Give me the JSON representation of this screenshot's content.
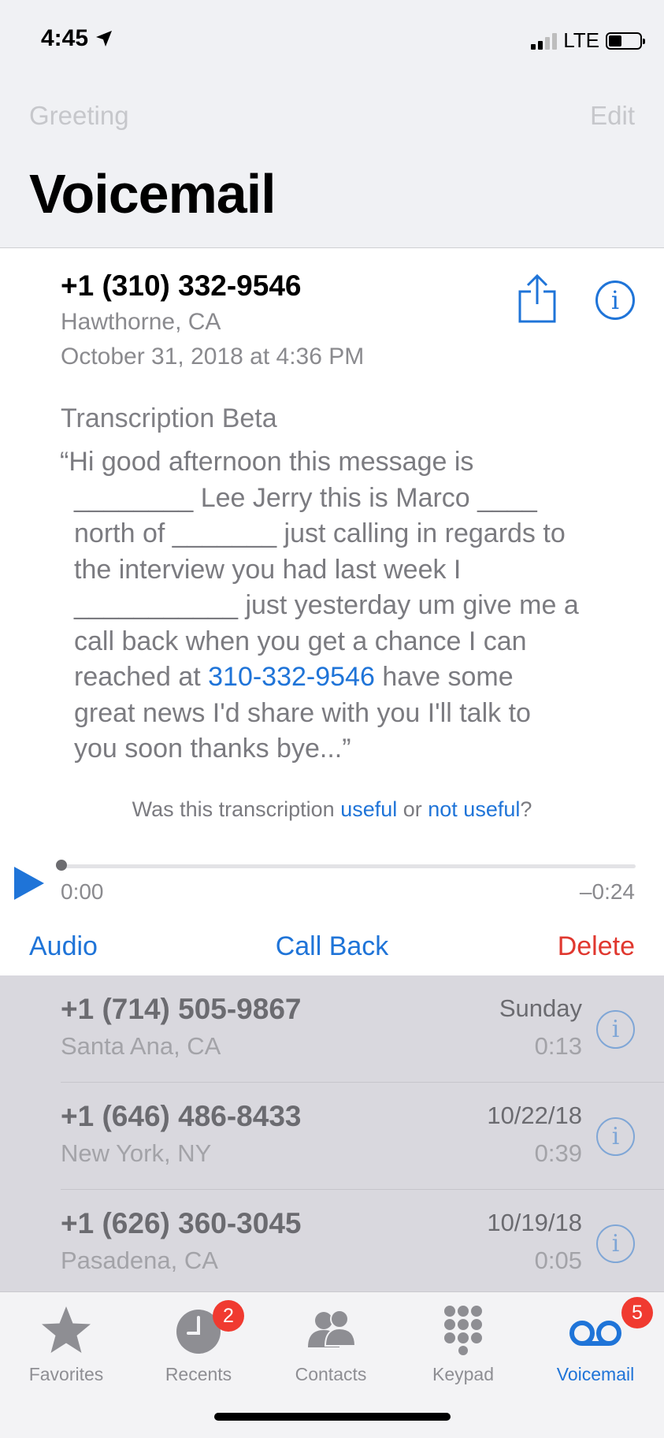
{
  "status_bar": {
    "time": "4:45",
    "network": "LTE"
  },
  "nav": {
    "greeting": "Greeting",
    "edit": "Edit",
    "title": "Voicemail"
  },
  "selected_voicemail": {
    "number": "+1 (310) 332-9546",
    "location": "Hawthorne, CA",
    "date": "October 31, 2018 at 4:36 PM",
    "transcription_label": "Transcription Beta",
    "transcript_lines": [
      "“Hi good afternoon this message is",
      "________ Lee Jerry this is Marco ____",
      "north of _______ just calling in regards to",
      "the interview you had last week I",
      "___________ just yesterday um give me a",
      "call back when you get a chance I can"
    ],
    "transcript_line7_before": "reached at ",
    "transcript_phone_link": "310-332-9546",
    "transcript_line7_after": " have some",
    "transcript_lines_end": [
      "great news I'd share with you I'll talk to",
      "you soon thanks bye...”"
    ],
    "feedback": {
      "prefix": "Was this transcription ",
      "useful": "useful",
      "or": " or ",
      "not_useful": "not useful",
      "suffix": "?"
    },
    "playback": {
      "elapsed": "0:00",
      "remaining": "–0:24",
      "progress": 0.0
    },
    "actions": {
      "audio": "Audio",
      "call_back": "Call Back",
      "delete": "Delete"
    }
  },
  "voicemails": [
    {
      "number": "+1 (714) 505-9867",
      "location": "Santa Ana, CA",
      "date": "Sunday",
      "duration": "0:13"
    },
    {
      "number": "+1 (646) 486-8433",
      "location": "New York, NY",
      "date": "10/22/18",
      "duration": "0:39"
    },
    {
      "number": "+1 (626) 360-3045",
      "location": "Pasadena, CA",
      "date": "10/19/18",
      "duration": "0:05"
    }
  ],
  "tabs": [
    {
      "label": "Favorites",
      "icon": "star-icon"
    },
    {
      "label": "Recents",
      "icon": "clock-icon",
      "badge": "2"
    },
    {
      "label": "Contacts",
      "icon": "contacts-icon"
    },
    {
      "label": "Keypad",
      "icon": "keypad-icon"
    },
    {
      "label": "Voicemail",
      "icon": "voicemail-icon",
      "badge": "5",
      "active": true
    }
  ],
  "colors": {
    "accent": "#1f74d8",
    "destructive": "#e0382f",
    "badge": "#f03a30"
  }
}
